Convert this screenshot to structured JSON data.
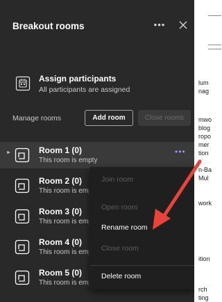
{
  "panel": {
    "title": "Breakout rooms",
    "more_icon": "more-options-icon",
    "close_icon": "close-icon"
  },
  "assign": {
    "title": "Assign participants",
    "subtitle": "All participants are assigned",
    "icon": "assign-participants-icon"
  },
  "manage": {
    "label": "Manage rooms",
    "add_room": "Add room",
    "close_rooms": "Close rooms"
  },
  "rooms": [
    {
      "name": "Room 1 (0)",
      "status": "This room is empty",
      "selected": true
    },
    {
      "name": "Room 2 (0)",
      "status": "This room is empty",
      "selected": false
    },
    {
      "name": "Room 3 (0)",
      "status": "This room is empty",
      "selected": false
    },
    {
      "name": "Room 4 (0)",
      "status": "This room is empty",
      "selected": false
    },
    {
      "name": "Room 5 (0)",
      "status": "This room is empty",
      "selected": false
    }
  ],
  "context_menu": {
    "items": [
      {
        "label": "Join room",
        "enabled": false
      },
      {
        "label": "Open room",
        "enabled": false
      },
      {
        "label": "Rename room",
        "enabled": true
      },
      {
        "label": "Close room",
        "enabled": false
      },
      {
        "label": "Delete room",
        "enabled": true
      }
    ]
  },
  "background_document": {
    "fragments": [
      "lum",
      "nag",
      "mwo",
      "blog",
      "ropo",
      "mer",
      "tion",
      "n-Ba",
      "Mul",
      "work",
      "ition",
      "rch",
      "ting"
    ]
  },
  "colors": {
    "panel_bg": "#292929",
    "menu_bg": "#1f1f1f",
    "accent": "#8f97f2",
    "annotation_arrow": "#e8443a"
  }
}
